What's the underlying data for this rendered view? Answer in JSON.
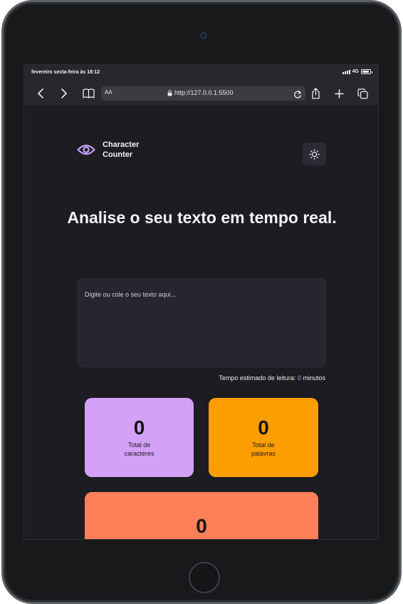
{
  "status_bar": {
    "time_text": "fevereiro sexta-feira às 18:12",
    "network": "4G",
    "battery_level": 0.9
  },
  "browser": {
    "text_size_label": "AA",
    "url": "http://127.0.0.1:5500",
    "icons": [
      "back-icon",
      "forward-icon",
      "bookmarks-icon",
      "lock-icon",
      "reload-icon",
      "share-icon",
      "new-tab-icon",
      "tabs-icon"
    ]
  },
  "app": {
    "brand_line1": "Character",
    "brand_line2": "Counter",
    "brand_icon": "eye-icon",
    "theme_icon": "sun-icon",
    "headline": "Analise o seu texto em tempo real.",
    "textarea_placeholder": "Digite ou cole o seu texto aqui...",
    "reading_time_label": "Tempo estimado de leitura:",
    "reading_time_value": "0",
    "reading_time_unit": "minutos",
    "cards": [
      {
        "value": "0",
        "label": "Total de caractéres",
        "color": "#d3a1f7"
      },
      {
        "value": "0",
        "label": "Total de palavras",
        "color": "#fd9e00"
      },
      {
        "value": "0",
        "color": "#fe8058"
      }
    ],
    "colors": {
      "background": "#1c1c22",
      "accent_purple": "#c89df3"
    }
  }
}
